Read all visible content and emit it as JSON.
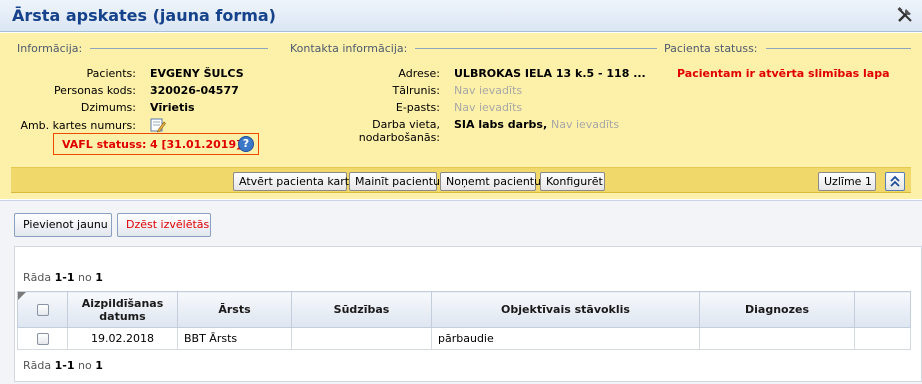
{
  "window": {
    "title": "Ārsta apskates (jauna forma)",
    "tool_icon": "tools-icon"
  },
  "sections": {
    "info_heading": "Informācija:",
    "contact_heading": "Kontakta informācija:",
    "status_heading": "Pacienta statuss:"
  },
  "patient": {
    "name_label": "Pacients:",
    "name": "EVGENY ŠULCS",
    "code_label": "Personas kods:",
    "code": "320026-04577",
    "gender_label": "Dzimums:",
    "gender": "Vīrietis",
    "card_label": "Amb. kartes numurs:",
    "vafl_label": "VAFL statuss:",
    "vafl_value": "4 [31.01.2019]"
  },
  "contact": {
    "address_label": "Adrese:",
    "address": "ULBROKAS IELA 13 k.5 - 118 ...",
    "phone_label": "Tālrunis:",
    "phone": "Nav ievadīts",
    "email_label": "E-pasts:",
    "email": "Nav ievadīts",
    "work_label": "Darba vieta, nodarbošanās:",
    "work": "SIA labs darbs,",
    "occupation": "Nav ievadīts"
  },
  "status": {
    "text": "Pacientam ir atvērta slimības lapa"
  },
  "toolbar": {
    "open_card": "Atvērt pacienta karti",
    "change_patient": "Mainīt pacientu",
    "remove_patient": "Noņemt pacientu",
    "configure": "Konfigurēt",
    "layout": "Uzlīme 1"
  },
  "actions": {
    "add_new": "Pievienot jaunu",
    "delete_selected": "Dzēst izvēlētās"
  },
  "pager": {
    "show": "Rāda",
    "range": "1-1",
    "of": "no",
    "total": "1"
  },
  "table": {
    "headers": [
      "Aizpildīšanas datums",
      "Ārsts",
      "Sūdzības",
      "Objektīvais stāvoklis",
      "Diagnozes"
    ],
    "rows": [
      {
        "date": "19.02.2018",
        "doctor": "BBT Ārsts",
        "complaints": "",
        "objective": "pārbaudie",
        "diagnoses": ""
      }
    ]
  },
  "colors": {
    "panel": "#fdf1a9",
    "title": "#15428b",
    "alert": "#e10000"
  }
}
